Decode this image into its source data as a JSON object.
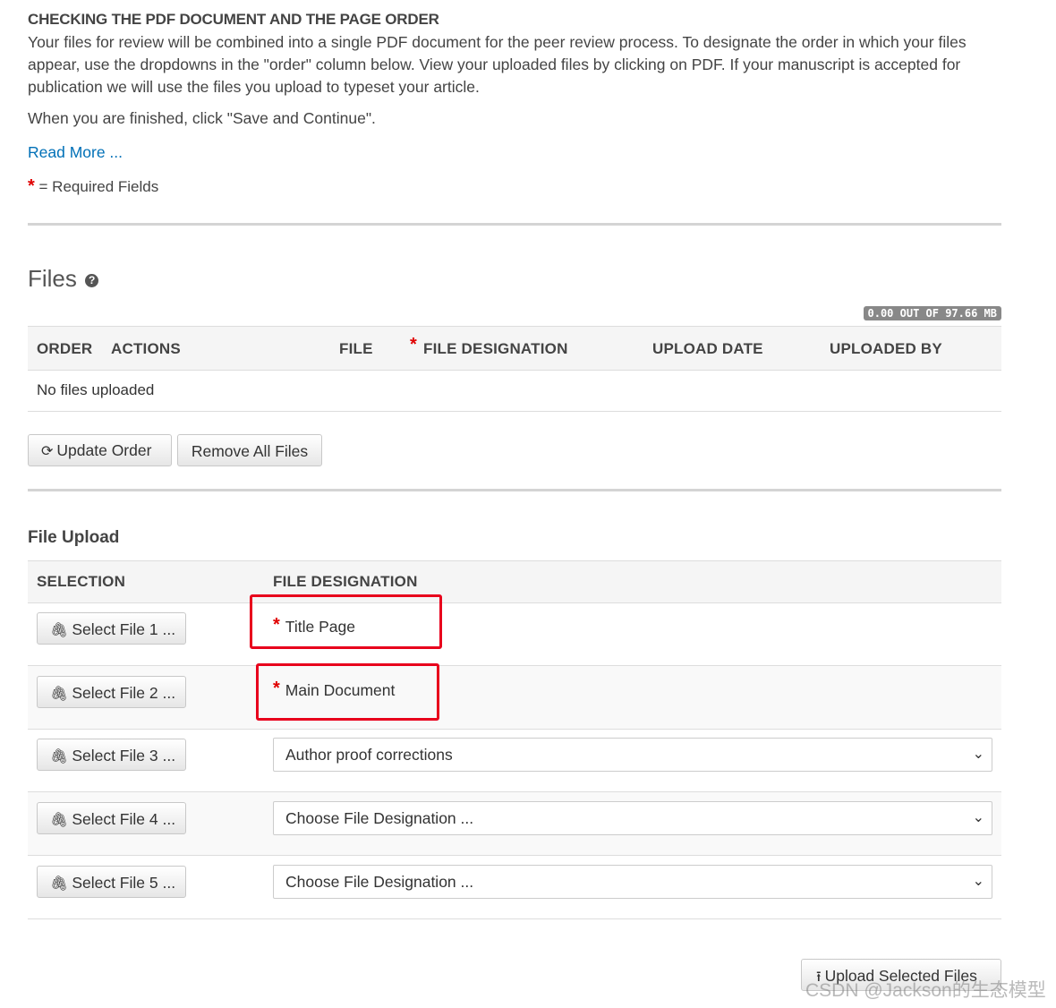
{
  "intro": {
    "heading": "CHECKING THE PDF DOCUMENT AND THE PAGE ORDER",
    "paragraph": "Your files for review will be combined into a single PDF document for the peer review process. To designate the order in which your files appear, use the dropdowns in the \"order\" column below. View your uploaded files by clicking on PDF. If your manuscript is accepted for publication we will use the files you upload to typeset your article.",
    "finish_text": "When you are finished, click \"Save and Continue\".",
    "read_more": "Read More ...",
    "required_star": "*",
    "required_text": "= Required Fields"
  },
  "files": {
    "title": "Files",
    "help_icon": "question-circle-icon",
    "quota": "0.00 OUT OF 97.66 MB",
    "columns": {
      "order": "ORDER",
      "actions": "ACTIONS",
      "file": "FILE",
      "designation": "FILE DESIGNATION",
      "upload_date": "UPLOAD DATE",
      "uploaded_by": "UPLOADED BY"
    },
    "empty_text": "No files uploaded",
    "update_order_button": "Update Order",
    "update_icon": "refresh-icon",
    "remove_all_button": "Remove All Files"
  },
  "upload": {
    "title": "File Upload",
    "columns": {
      "selection": "SELECTION",
      "designation": "FILE DESIGNATION"
    },
    "paperclip_icon": "paperclip-icon",
    "rows": [
      {
        "button": "Select File 1 ...",
        "designation": "Title Page",
        "required": true
      },
      {
        "button": "Select File 2 ...",
        "designation": "Main Document",
        "required": true
      },
      {
        "button": "Select File 3 ...",
        "selected": "Author proof corrections"
      },
      {
        "button": "Select File 4 ...",
        "selected": "Choose File Designation ..."
      },
      {
        "button": "Select File 5 ...",
        "selected": "Choose File Designation ..."
      }
    ],
    "upload_button": "Upload Selected Files",
    "upload_icon": "upload-icon"
  },
  "annotation_color": "#e8001c",
  "link_color": "#0070b7",
  "watermark": "CSDN @Jackson的生态模型"
}
